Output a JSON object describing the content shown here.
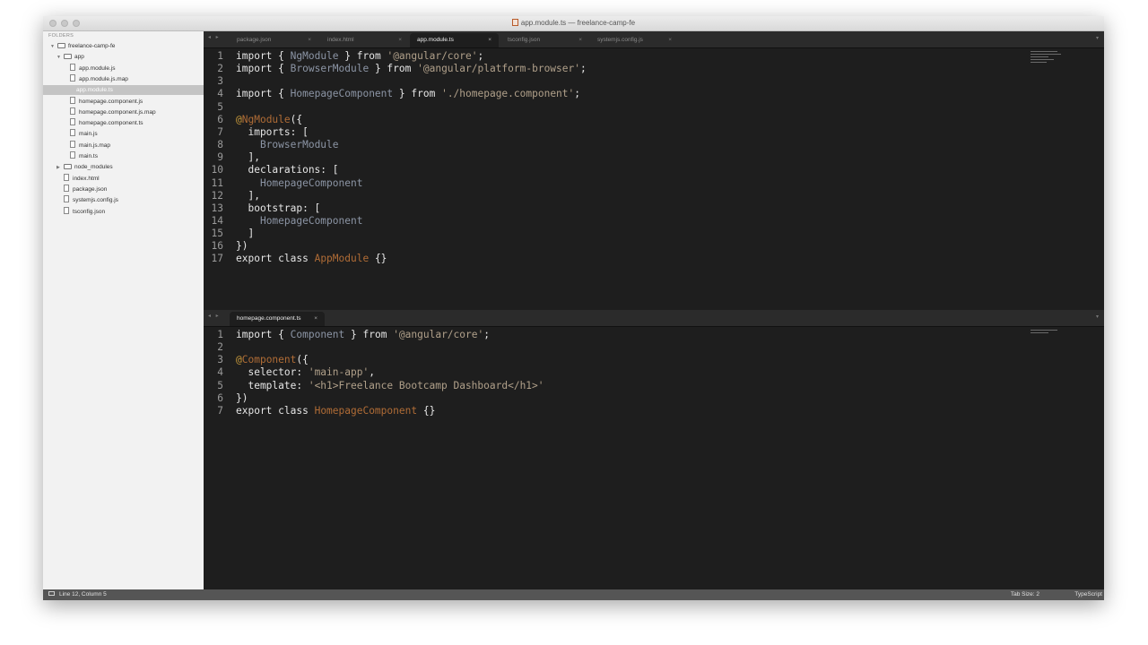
{
  "window": {
    "title": "app.module.ts — freelance-camp-fe"
  },
  "sidebar": {
    "header": "FOLDERS",
    "items": [
      {
        "label": "freelance-camp-fe",
        "type": "folder",
        "depth": 0,
        "expanded": true,
        "selected": false
      },
      {
        "label": "app",
        "type": "folder",
        "depth": 1,
        "expanded": true,
        "selected": false
      },
      {
        "label": "app.module.js",
        "type": "file",
        "depth": 2,
        "selected": false
      },
      {
        "label": "app.module.js.map",
        "type": "file",
        "depth": 2,
        "selected": false
      },
      {
        "label": "app.module.ts",
        "type": "file",
        "depth": 2,
        "selected": true
      },
      {
        "label": "homepage.component.js",
        "type": "file",
        "depth": 2,
        "selected": false
      },
      {
        "label": "homepage.component.js.map",
        "type": "file",
        "depth": 2,
        "selected": false
      },
      {
        "label": "homepage.component.ts",
        "type": "file",
        "depth": 2,
        "selected": false
      },
      {
        "label": "main.js",
        "type": "file",
        "depth": 2,
        "selected": false
      },
      {
        "label": "main.js.map",
        "type": "file",
        "depth": 2,
        "selected": false
      },
      {
        "label": "main.ts",
        "type": "file",
        "depth": 2,
        "selected": false
      },
      {
        "label": "node_modules",
        "type": "folder",
        "depth": 1,
        "expanded": false,
        "selected": false
      },
      {
        "label": "index.html",
        "type": "file",
        "depth": 1,
        "selected": false
      },
      {
        "label": "package.json",
        "type": "file",
        "depth": 1,
        "selected": false
      },
      {
        "label": "systemjs.config.js",
        "type": "file",
        "depth": 1,
        "selected": false
      },
      {
        "label": "tsconfig.json",
        "type": "file",
        "depth": 1,
        "selected": false
      }
    ]
  },
  "top_tabs": [
    {
      "label": "package.json",
      "close": "×",
      "active": false
    },
    {
      "label": "index.html",
      "close": "×",
      "active": false
    },
    {
      "label": "app.module.ts",
      "close": "×",
      "active": true
    },
    {
      "label": "tsconfig.json",
      "close": "×",
      "active": false
    },
    {
      "label": "systemjs.config.js",
      "close": "×",
      "active": false
    }
  ],
  "bottom_tabs": [
    {
      "label": "homepage.component.ts",
      "close": "×",
      "active": true
    }
  ],
  "nav_arrows": "◂ ▸",
  "dropdown_icon": "▾",
  "top_code": [
    {
      "n": "1",
      "t": [
        [
          "kw",
          "import"
        ],
        [
          "plain",
          " { "
        ],
        [
          "cls",
          "NgModule"
        ],
        [
          "plain",
          " } "
        ],
        [
          "kw",
          "from"
        ],
        [
          "plain",
          " "
        ],
        [
          "str",
          "'@angular/core'"
        ],
        [
          "plain",
          ";"
        ]
      ]
    },
    {
      "n": "2",
      "t": [
        [
          "kw",
          "import"
        ],
        [
          "plain",
          " { "
        ],
        [
          "cls",
          "BrowserModule"
        ],
        [
          "plain",
          " } "
        ],
        [
          "kw",
          "from"
        ],
        [
          "plain",
          " "
        ],
        [
          "str",
          "'@angular/platform-browser'"
        ],
        [
          "plain",
          ";"
        ]
      ]
    },
    {
      "n": "3",
      "t": []
    },
    {
      "n": "4",
      "t": [
        [
          "kw",
          "import"
        ],
        [
          "plain",
          " { "
        ],
        [
          "cls",
          "HomepageComponent"
        ],
        [
          "plain",
          " } "
        ],
        [
          "kw",
          "from"
        ],
        [
          "plain",
          " "
        ],
        [
          "str",
          "'./homepage.component'"
        ],
        [
          "plain",
          ";"
        ]
      ]
    },
    {
      "n": "5",
      "t": []
    },
    {
      "n": "6",
      "t": [
        [
          "dec",
          "@"
        ],
        [
          "decname",
          "NgModule"
        ],
        [
          "plain",
          "({"
        ]
      ]
    },
    {
      "n": "7",
      "t": [
        [
          "plain",
          "  imports: ["
        ]
      ]
    },
    {
      "n": "8",
      "t": [
        [
          "plain",
          "    "
        ],
        [
          "cls",
          "BrowserModule"
        ]
      ]
    },
    {
      "n": "9",
      "t": [
        [
          "plain",
          "  ],"
        ]
      ]
    },
    {
      "n": "10",
      "t": [
        [
          "plain",
          "  declarations: ["
        ]
      ]
    },
    {
      "n": "11",
      "t": [
        [
          "plain",
          "    "
        ],
        [
          "cls",
          "HomepageComponent"
        ]
      ]
    },
    {
      "n": "12",
      "t": [
        [
          "plain",
          "  ],"
        ]
      ]
    },
    {
      "n": "13",
      "t": [
        [
          "plain",
          "  bootstrap: ["
        ]
      ]
    },
    {
      "n": "14",
      "t": [
        [
          "plain",
          "    "
        ],
        [
          "cls",
          "HomepageComponent"
        ]
      ]
    },
    {
      "n": "15",
      "t": [
        [
          "plain",
          "  ]"
        ]
      ]
    },
    {
      "n": "16",
      "t": [
        [
          "plain",
          "})"
        ]
      ]
    },
    {
      "n": "17",
      "t": [
        [
          "kw",
          "export class"
        ],
        [
          "plain",
          " "
        ],
        [
          "decname",
          "AppModule"
        ],
        [
          "plain",
          " {}"
        ]
      ]
    }
  ],
  "bottom_code": [
    {
      "n": "1",
      "t": [
        [
          "kw",
          "import"
        ],
        [
          "plain",
          " { "
        ],
        [
          "cls",
          "Component"
        ],
        [
          "plain",
          " } "
        ],
        [
          "kw",
          "from"
        ],
        [
          "plain",
          " "
        ],
        [
          "str",
          "'@angular/core'"
        ],
        [
          "plain",
          ";"
        ]
      ]
    },
    {
      "n": "2",
      "t": []
    },
    {
      "n": "3",
      "t": [
        [
          "dec",
          "@"
        ],
        [
          "decname",
          "Component"
        ],
        [
          "plain",
          "({"
        ]
      ]
    },
    {
      "n": "4",
      "t": [
        [
          "plain",
          "  selector: "
        ],
        [
          "str",
          "'main-app'"
        ],
        [
          "plain",
          ","
        ]
      ]
    },
    {
      "n": "5",
      "t": [
        [
          "plain",
          "  template: "
        ],
        [
          "str",
          "'<h1>Freelance Bootcamp Dashboard</h1>'"
        ]
      ]
    },
    {
      "n": "6",
      "t": [
        [
          "plain",
          "})"
        ]
      ]
    },
    {
      "n": "7",
      "t": [
        [
          "kw",
          "export class"
        ],
        [
          "plain",
          " "
        ],
        [
          "decname",
          "HomepageComponent"
        ],
        [
          "plain",
          " {}"
        ]
      ]
    }
  ],
  "status": {
    "position": "Line 12, Column 5",
    "tab_size": "Tab Size: 2",
    "syntax": "TypeScript"
  },
  "colors": {
    "editor_bg": "#1e1e1e",
    "sidebar_bg": "#f2f2f2",
    "class_name": "#8c95a5",
    "string": "#b0a08a",
    "decorator": "#b06c36"
  }
}
